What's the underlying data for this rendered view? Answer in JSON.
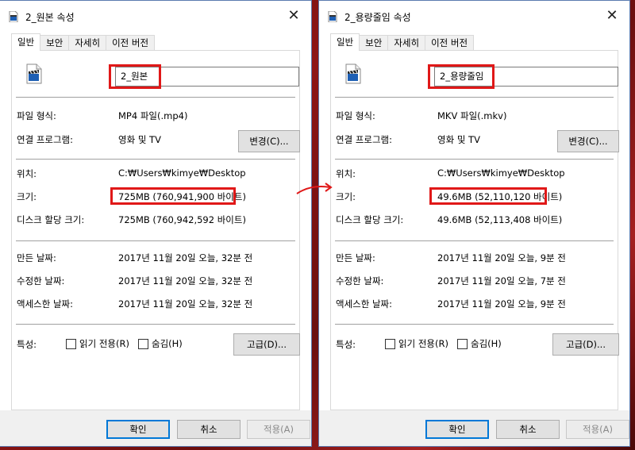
{
  "left": {
    "title": "2_원본 속성",
    "tabs": [
      "일반",
      "보안",
      "자세히",
      "이전 버전"
    ],
    "name_value": "2_원본",
    "labels": {
      "type": "파일 형식:",
      "opens": "연결 프로그램:",
      "location": "위치:",
      "size": "크기:",
      "disk": "디스크 할당 크기:",
      "created": "만든 날짜:",
      "modified": "수정한 날짜:",
      "accessed": "액세스한 날짜:",
      "attrs": "특성:"
    },
    "values": {
      "type": "MP4 파일(.mp4)",
      "opens": "영화 및 TV",
      "location": "C:₩Users₩kimye₩Desktop",
      "size": "725MB (760,941,900 바이트)",
      "disk": "725MB (760,942,592 바이트)",
      "created": "2017년 11월 20일 오늘, 32분 전",
      "modified": "2017년 11월 20일 오늘, 32분 전",
      "accessed": "2017년 11월 20일 오늘, 32분 전"
    },
    "change_btn": "변경(C)...",
    "readonly": "읽기 전용(R)",
    "hidden": "숨김(H)",
    "advanced_btn": "고급(D)...",
    "ok": "확인",
    "cancel": "취소",
    "apply": "적용(A)"
  },
  "right": {
    "title": "2_용량줄임 속성",
    "tabs": [
      "일반",
      "보안",
      "자세히",
      "이전 버전"
    ],
    "name_value": "2_용량줄임",
    "labels": {
      "type": "파일 형식:",
      "opens": "연결 프로그램:",
      "location": "위치:",
      "size": "크기:",
      "disk": "디스크 할당 크기:",
      "created": "만든 날짜:",
      "modified": "수정한 날짜:",
      "accessed": "액세스한 날짜:",
      "attrs": "특성:"
    },
    "values": {
      "type": "MKV 파일(.mkv)",
      "opens": "영화 및 TV",
      "location": "C:₩Users₩kimye₩Desktop",
      "size": "49.6MB (52,110,120 바이트)",
      "disk": "49.6MB (52,113,408 바이트)",
      "created": "2017년 11월 20일 오늘, 9분 전",
      "modified": "2017년 11월 20일 오늘, 7분 전",
      "accessed": "2017년 11월 20일 오늘, 9분 전"
    },
    "change_btn": "변경(C)...",
    "readonly": "읽기 전용(R)",
    "hidden": "숨김(H)",
    "advanced_btn": "고급(D)...",
    "ok": "확인",
    "cancel": "취소",
    "apply": "적용(A)"
  },
  "annotation": {
    "highlight_color": "#e01818",
    "arrow_icon": "red-arrow-icon"
  }
}
